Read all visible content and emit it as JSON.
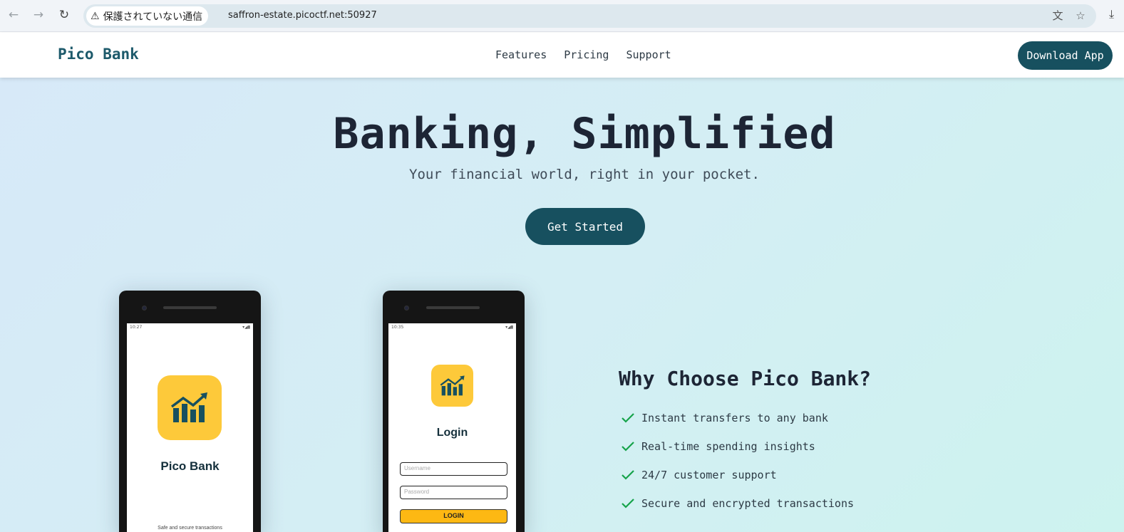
{
  "browser": {
    "security_label": "保護されていない通信",
    "url": "saffron-estate.picoctf.net:50927"
  },
  "header": {
    "brand": "Pico Bank",
    "nav": [
      "Features",
      "Pricing",
      "Support"
    ],
    "download_label": "Download App"
  },
  "hero": {
    "title": "Banking, Simplified",
    "subtitle": "Your financial world, right in your pocket.",
    "cta_label": "Get Started"
  },
  "phone_splash": {
    "time": "10:27",
    "app_name": "Pico Bank",
    "tagline": "Safe and secure transactions"
  },
  "phone_login": {
    "time": "10:35",
    "title": "Login",
    "username_placeholder": "Username",
    "password_placeholder": "Password",
    "login_label": "LOGIN"
  },
  "features": {
    "title": "Why Choose Pico Bank?",
    "items": [
      "Instant transfers to any bank",
      "Real-time spending insights",
      "24/7 customer support",
      "Secure and encrypted transactions"
    ]
  },
  "colors": {
    "brand": "#17505f",
    "accent_yellow": "#fdc93a",
    "check_green": "#16a34a"
  }
}
